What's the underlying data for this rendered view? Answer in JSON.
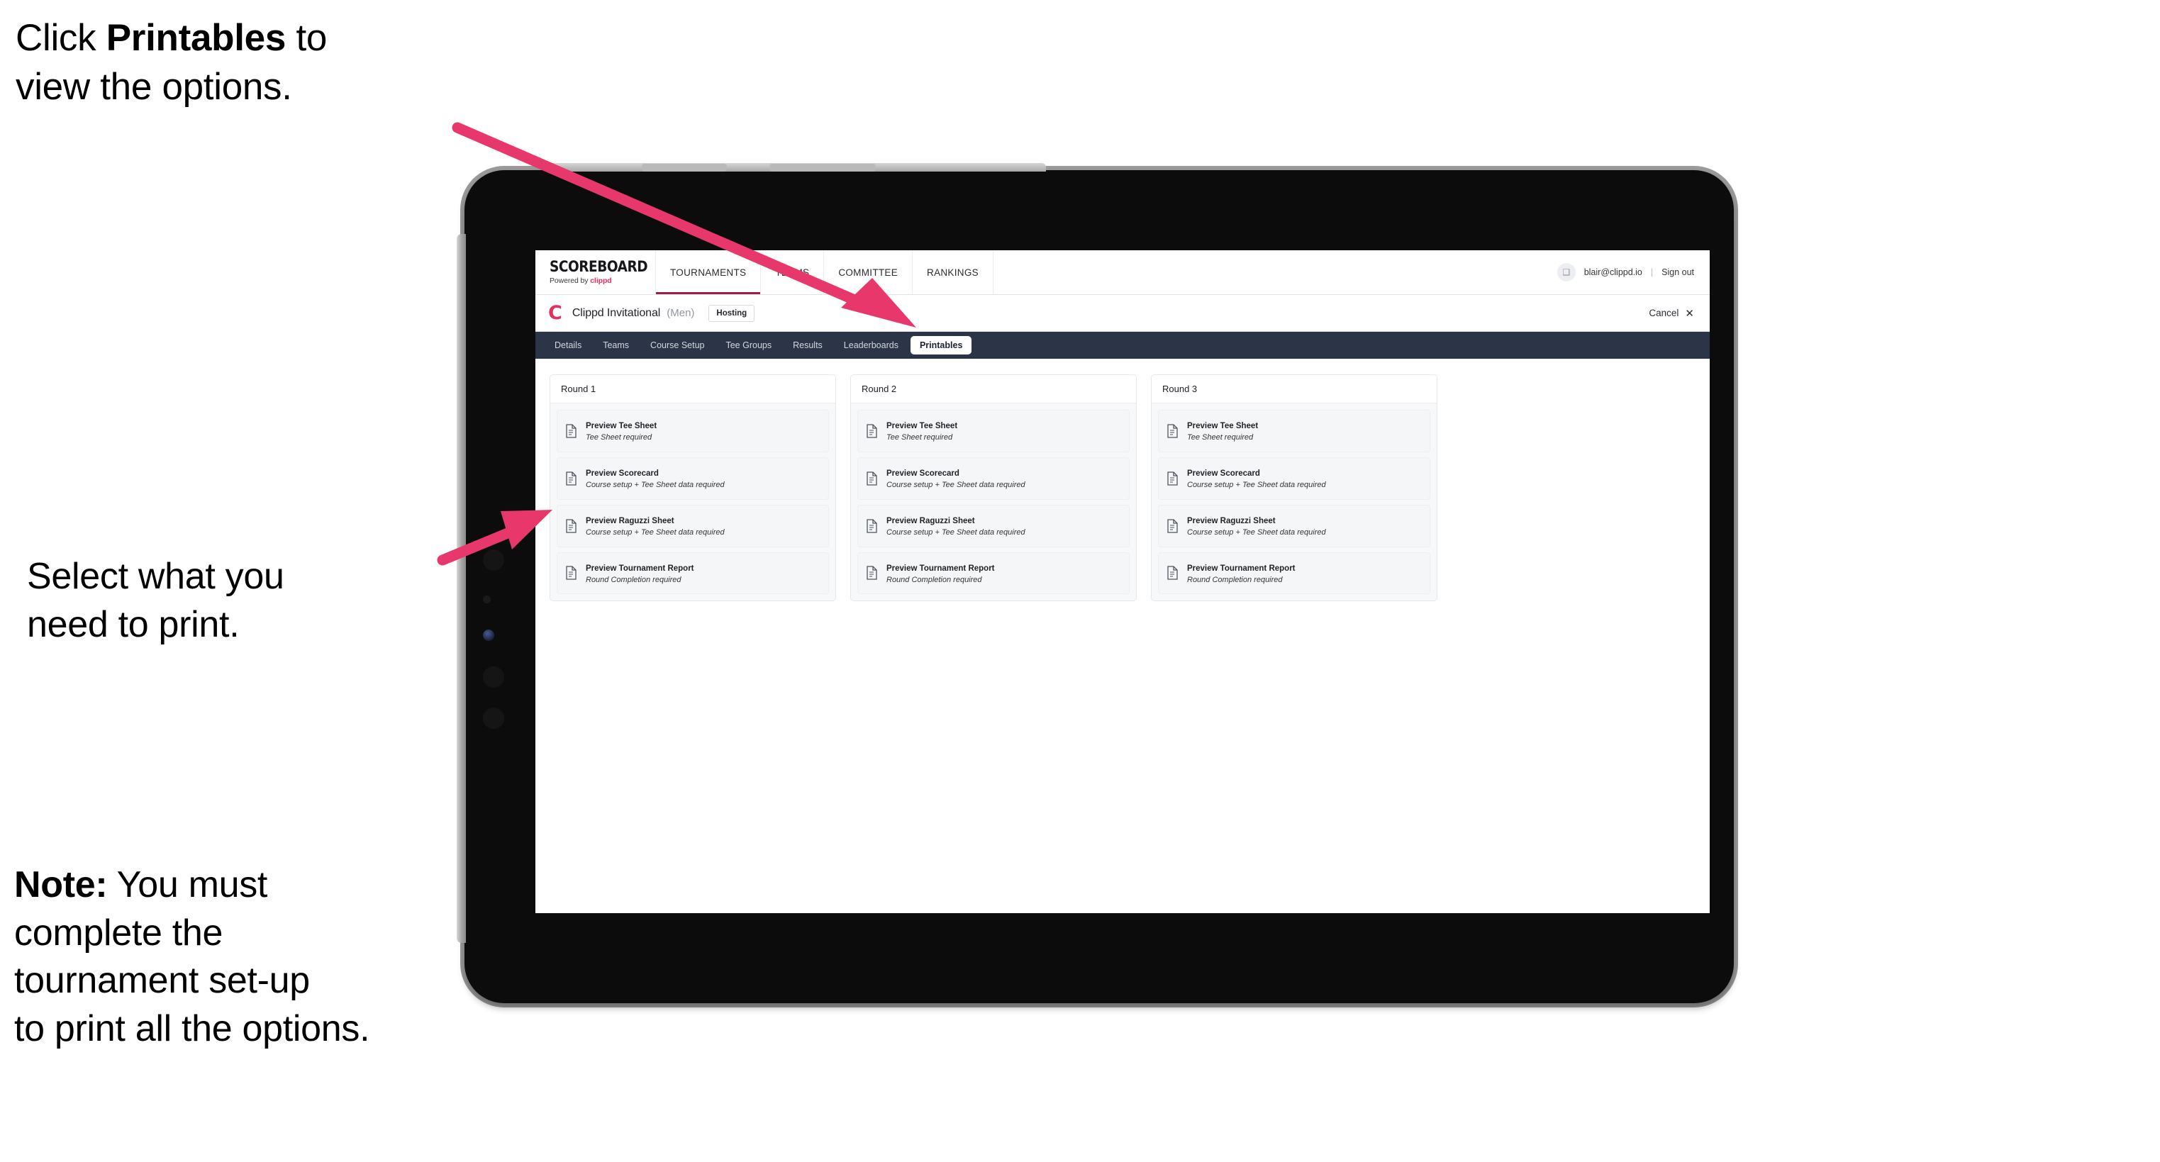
{
  "annotations": {
    "click_printables": {
      "prefix": "Click ",
      "bold": "Printables",
      "suffix": " to\nview the options."
    },
    "select_print": "Select what you\n need to print.",
    "note": {
      "bold": "Note:",
      "text": " You must\ncomplete the\ntournament set-up\nto print all the options."
    }
  },
  "colors": {
    "arrow": "#E8376B",
    "brand_pink": "#E0315C",
    "subnav_bg": "#2B3547",
    "active_underline": "#9D1F45"
  },
  "app": {
    "logo": {
      "word": "SCOREBOARD",
      "powered_prefix": "Powered by ",
      "powered_brand": "clippd"
    },
    "topnav": [
      {
        "label": "TOURNAMENTS",
        "active": true
      },
      {
        "label": "TEAMS",
        "active": false
      },
      {
        "label": "COMMITTEE",
        "active": false
      },
      {
        "label": "RANKINGS",
        "active": false
      }
    ],
    "account": {
      "avatar_glyph": "❑",
      "email": "blair@clippd.io",
      "separator": "|",
      "sign_out": "Sign out"
    },
    "tournament": {
      "mark": "C",
      "name": "Clippd Invitational",
      "gender": "(Men)",
      "badge": "Hosting",
      "cancel_label": "Cancel",
      "cancel_icon": "✕"
    },
    "subtabs": [
      {
        "label": "Details",
        "active": false
      },
      {
        "label": "Teams",
        "active": false
      },
      {
        "label": "Course Setup",
        "active": false
      },
      {
        "label": "Tee Groups",
        "active": false
      },
      {
        "label": "Results",
        "active": false
      },
      {
        "label": "Leaderboards",
        "active": false
      },
      {
        "label": "Printables",
        "active": true
      }
    ],
    "rounds": [
      {
        "title": "Round 1",
        "items": [
          {
            "title": "Preview Tee Sheet",
            "sub": "Tee Sheet required"
          },
          {
            "title": "Preview Scorecard",
            "sub": "Course setup + Tee Sheet data required"
          },
          {
            "title": "Preview Raguzzi Sheet",
            "sub": "Course setup + Tee Sheet data required"
          },
          {
            "title": "Preview Tournament Report",
            "sub": "Round Completion required"
          }
        ]
      },
      {
        "title": "Round 2",
        "items": [
          {
            "title": "Preview Tee Sheet",
            "sub": "Tee Sheet required"
          },
          {
            "title": "Preview Scorecard",
            "sub": "Course setup + Tee Sheet data required"
          },
          {
            "title": "Preview Raguzzi Sheet",
            "sub": "Course setup + Tee Sheet data required"
          },
          {
            "title": "Preview Tournament Report",
            "sub": "Round Completion required"
          }
        ]
      },
      {
        "title": "Round 3",
        "items": [
          {
            "title": "Preview Tee Sheet",
            "sub": "Tee Sheet required"
          },
          {
            "title": "Preview Scorecard",
            "sub": "Course setup + Tee Sheet data required"
          },
          {
            "title": "Preview Raguzzi Sheet",
            "sub": "Course setup + Tee Sheet data required"
          },
          {
            "title": "Preview Tournament Report",
            "sub": "Round Completion required"
          }
        ]
      }
    ]
  }
}
